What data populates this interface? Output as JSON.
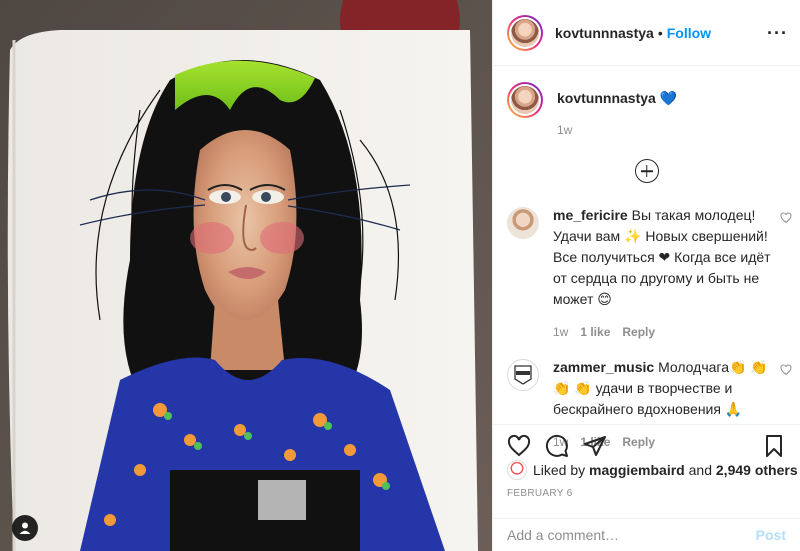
{
  "post": {
    "author": "kovtunnnastya",
    "separator": "•",
    "follow_label": "Follow",
    "more_label": "···"
  },
  "caption": {
    "username": "kovtunnnastya",
    "emoji": "💙",
    "time": "1w"
  },
  "comments": [
    {
      "username": "me_fericire",
      "text": "Вы такая молодец! Удачи вам ✨ Новых свершений! Все получиться ❤ Когда все идёт от сердца по другому и быть не может 😊",
      "time": "1w",
      "likes": "1 like",
      "reply": "Reply"
    },
    {
      "username": "zammer_music",
      "text": "Молодчага👏 👏 👏 👏 удачи в творчестве и бескрайнего вдохновения 🙏",
      "time": "1w",
      "likes": "1 like",
      "reply": "Reply"
    }
  ],
  "likes": {
    "prefix": "Liked by",
    "user": "maggiembaird",
    "and": "and",
    "others": "2,949 others"
  },
  "date": "FEBRUARY 6",
  "add_comment": {
    "placeholder": "Add a comment…",
    "post_label": "Post"
  },
  "colors": {
    "link_blue": "#0095f6",
    "muted": "#8e8e8e",
    "post_disabled": "#b2dffc",
    "heart_blue": "#3897f0"
  }
}
